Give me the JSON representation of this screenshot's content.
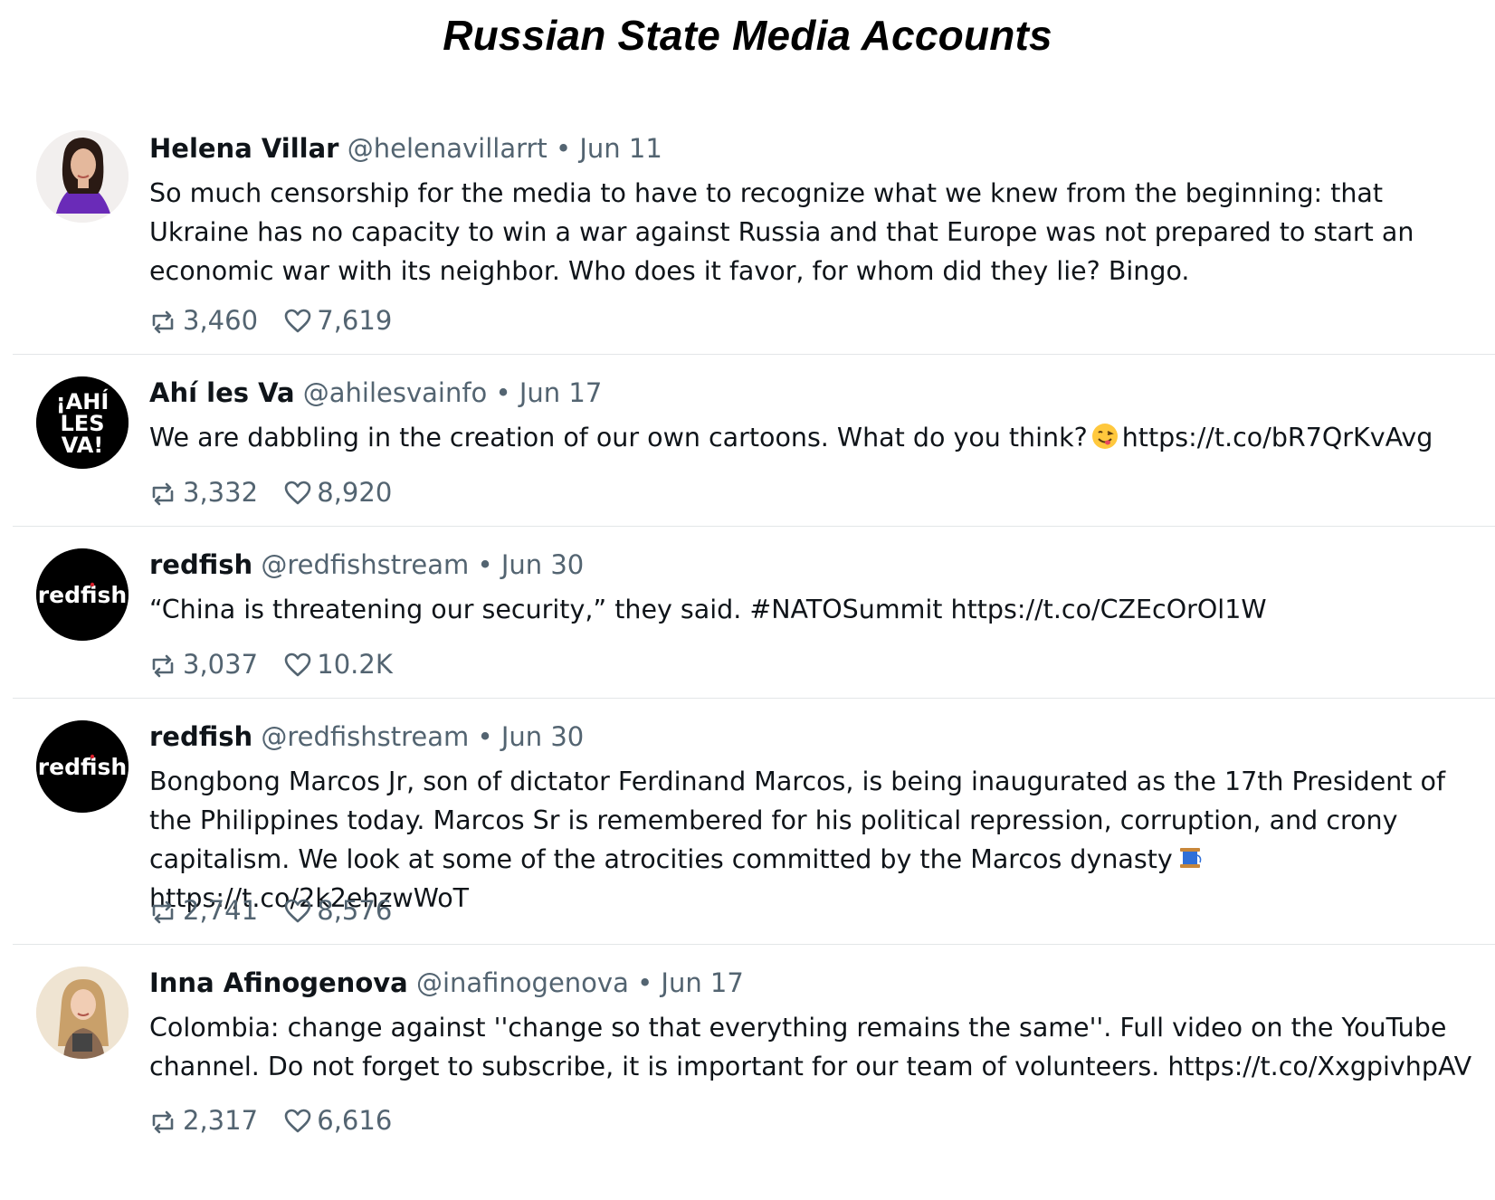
{
  "page": {
    "title": "Russian State Media Accounts"
  },
  "tweets": [
    {
      "name": "Helena Villar",
      "handle": "@helenavillarrt",
      "date": "Jun 11",
      "text": "So much censorship for the media to have to recognize what we knew from the beginning: that Ukraine has no capacity to win a war against Russia and that Europe was not prepared to start an economic war with its neighbor. Who does it favor, for whom did they lie? Bingo.",
      "retweets": "3,460",
      "likes": "7,619",
      "avatar_icon": "woman-portrait-icon"
    },
    {
      "name": "Ahí les Va",
      "handle": "@ahilesvainfo",
      "date": "Jun 17",
      "text": "We are dabbling in the creation of our own cartoons. What do you think?",
      "emoji": "face-savoring-food-emoji",
      "link": "https://t.co/bR7QrKvAvg",
      "retweets": "3,332",
      "likes": "8,920",
      "avatar_text": [
        "¡AHÍ",
        "LES",
        "VA!"
      ]
    },
    {
      "name": "redfish",
      "handle": "@redfishstream",
      "date": "Jun 30",
      "text": "“China is threatening our security,” they said. #NATOSummit https://t.co/CZEcOrOl1W",
      "retweets": "3,037",
      "likes": "10.2K",
      "avatar_text": "redfish"
    },
    {
      "name": "redfish",
      "handle": "@redfishstream",
      "date": "Jun 30",
      "text": "Bongbong Marcos Jr, son of dictator Ferdinand Marcos, is being inaugurated as the 17th President of the Philippines today. Marcos Sr is remembered for his political repression, corruption, and crony capitalism. We look at some of the atrocities committed by the Marcos dynasty",
      "emoji": "spool-of-thread-emoji",
      "link": "https://t.co/2k2ehzwWoT",
      "retweets": "2,741",
      "likes": "8,576",
      "avatar_text": "redfish"
    },
    {
      "name": "Inna Afinogenova",
      "handle": "@inafinogenova",
      "date": "Jun 17",
      "text": "Colombia: change against ''change so that everything remains the same''. Full video on the YouTube channel. Do not forget to subscribe, it is important for our team of volunteers. https://t.co/XxgpivhpAV",
      "retweets": "2,317",
      "likes": "6,616",
      "avatar_icon": "woman-portrait-icon"
    }
  ],
  "separator": "•"
}
